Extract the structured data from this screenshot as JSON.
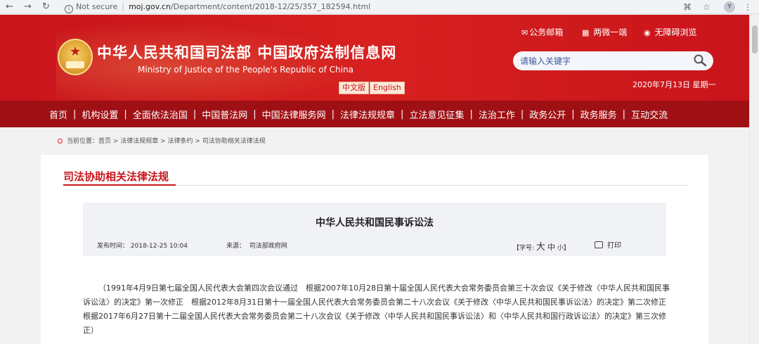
{
  "browser": {
    "back": "←",
    "forward": "→",
    "reload": "↻",
    "security": "Not secure",
    "url_host": "moj.gov.cn",
    "url_path": "/Department/content/2018-12/25/357_182594.html",
    "avatar_letter": "Y"
  },
  "header": {
    "title": "中华人民共和国司法部 中国政府法制信息网",
    "subtitle": "Ministry of Justice of the People's Republic of China",
    "lang_cn": "中文版",
    "lang_en": "English",
    "links": [
      {
        "icon": "mail-icon",
        "label": "公务邮箱"
      },
      {
        "icon": "qr-icon",
        "label": "两微一端"
      },
      {
        "icon": "eye-icon",
        "label": "无障碍浏览"
      }
    ],
    "search_placeholder": "请输入关键字",
    "date": "2020年7月13日 星期一"
  },
  "nav": [
    "首页",
    "机构设置",
    "全面依法治国",
    "中国普法网",
    "中国法律服务网",
    "法律法规规章",
    "立法意见征集",
    "法治工作",
    "政务公开",
    "政务服务",
    "互动交流"
  ],
  "breadcrumb": "当前位置：首页 > 法律法规规章 > 法律条约 > 司法协助相关法律法规",
  "section": {
    "title": "司法协助相关法律法规"
  },
  "article": {
    "title": "中华人民共和国民事诉讼法",
    "publish_label": "发布时间：",
    "publish_time": "2018-12-25 10:04",
    "source_label": "来源：",
    "source": "司法部政府网",
    "font_label": "【字号:",
    "font_large": "大",
    "font_medium": "中",
    "font_small": "小",
    "font_close": "】",
    "print": "打印",
    "body": "（1991年4月9日第七届全国人民代表大会第四次会议通过　根据2007年10月28日第十届全国人民代表大会常务委员会第三十次会议《关于修改〈中华人民共和国民事诉讼法〉的决定》第一次修正　根据2012年8月31日第十一届全国人民代表大会常务委员会第二十八次会议《关于修改〈中华人民共和国民事诉讼法〉的决定》第二次修正　根据2017年6月27日第十二届全国人民代表大会常务委员会第二十八次会议《关于修改〈中华人民共和国民事诉讼法〉和〈中华人民共和国行政诉讼法〉的决定》第三次修正）"
  },
  "colors": {
    "brand_red": "#c8141b",
    "nav_red": "#9f1014"
  }
}
